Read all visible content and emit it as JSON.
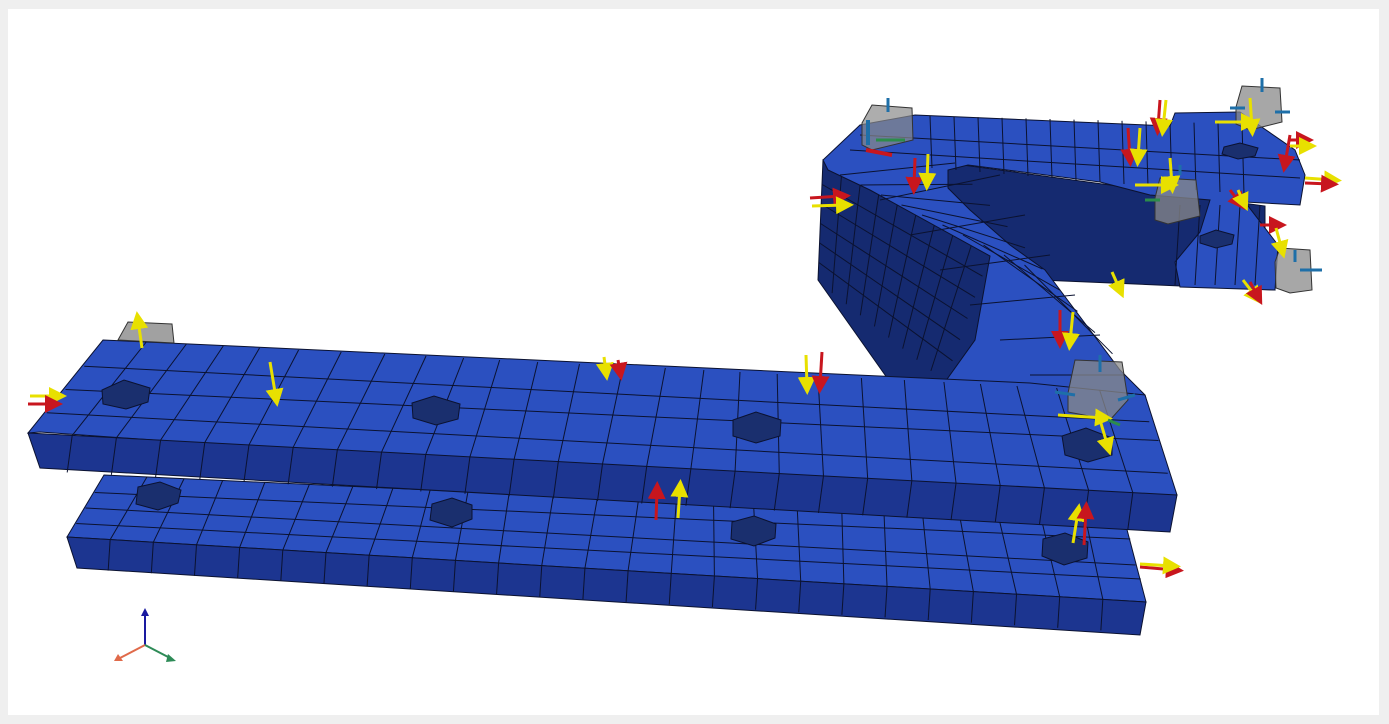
{
  "viewport": {
    "background": "#ffffff",
    "frame_color": "#efefef"
  },
  "model": {
    "top_color": "#2b50c0",
    "side_color": "#1c3590",
    "inner_color": "#152a70",
    "hole_color": "#1a2f6e",
    "edge_color": "#0b1230"
  },
  "markers": {
    "load_color": "#e8e000",
    "reaction_color": "#c8161e",
    "gizmo_x_color": "#2c8c4a",
    "gizmo_y_color": "#1e6fa8",
    "gizmo_box_color": "#8a8a8a"
  },
  "axis_triad": {
    "x_color": "#e06a4a",
    "y_color": "#2e8b57",
    "z_color": "#1a1aa0"
  }
}
